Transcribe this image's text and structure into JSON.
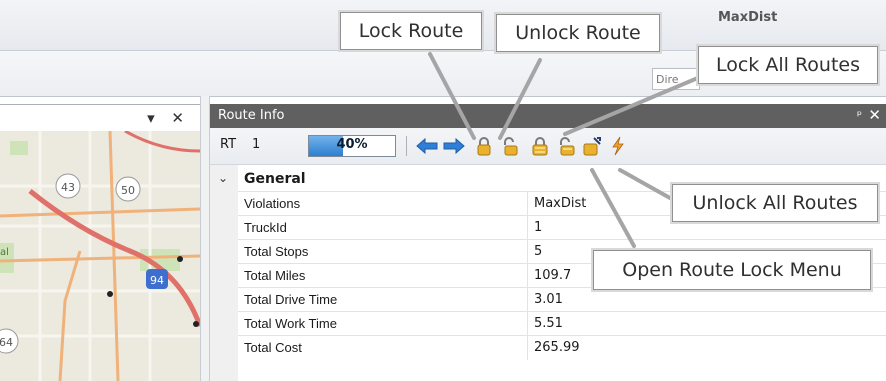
{
  "ribbon": {
    "title_fragment": "MaxDist",
    "dir_fragment": "Dire"
  },
  "map_panel": {
    "header_icons": "▾ ✕",
    "route_labels": [
      "43",
      "50",
      "94",
      "64"
    ],
    "left_edge_text": "al"
  },
  "route_info": {
    "title": "Route Info",
    "pin_icon": "ᵖ",
    "close_icon": "✕",
    "toolbar": {
      "rt_label": "RT",
      "rt_value": "1",
      "progress_percent": 40,
      "progress_text": "40%",
      "icons": [
        "arrow-left-icon",
        "arrow-right-icon",
        "lock-route-icon",
        "unlock-route-icon",
        "lock-all-routes-icon",
        "open-route-lock-menu-icon",
        "unlock-all-routes-icon",
        "lightning-icon"
      ]
    },
    "section": {
      "title": "General",
      "rows": [
        {
          "label": "Violations",
          "value": "MaxDist"
        },
        {
          "label": "TruckId",
          "value": "1"
        },
        {
          "label": "Total Stops",
          "value": "5"
        },
        {
          "label": "Total Miles",
          "value": "109.7"
        },
        {
          "label": "Total Drive Time",
          "value": "3.01"
        },
        {
          "label": "Total Work Time",
          "value": "5.51"
        },
        {
          "label": "Total Cost",
          "value": "265.99"
        }
      ]
    }
  },
  "callouts": {
    "lock_route": "Lock Route",
    "unlock_route": "Unlock Route",
    "lock_all_routes": "Lock All Routes",
    "unlock_all_routes": "Unlock All Routes",
    "open_route_lock_menu": "Open Route Lock Menu"
  },
  "colors": {
    "panel_header": "#606060",
    "progress_fill": "#2d7fd0",
    "lock_gold": "#e9b12c",
    "arrow_blue": "#2f7fd6",
    "map_road_red": "#e0706a",
    "map_road_orange": "#f0b27a"
  }
}
